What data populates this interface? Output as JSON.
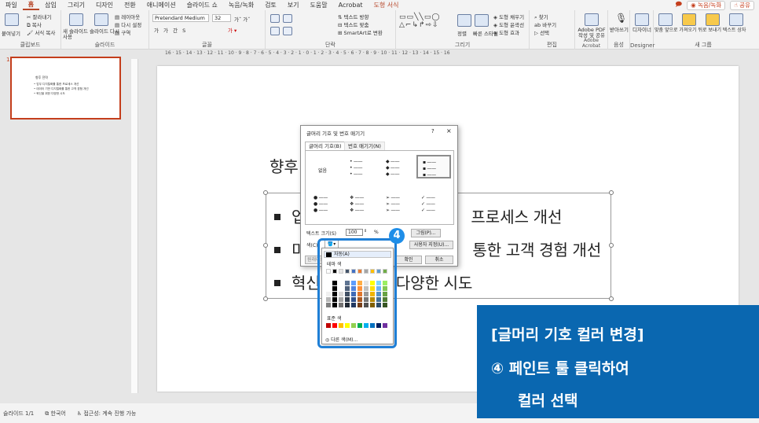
{
  "menubar": {
    "items": [
      "파일",
      "홈",
      "삽입",
      "그리기",
      "디자인",
      "전환",
      "애니메이션",
      "슬라이드 쇼",
      "녹음/녹화",
      "검토",
      "보기",
      "도움말",
      "Acrobat",
      "도형 서식"
    ],
    "active_index": 1,
    "contextual_index": 13,
    "record_label": "◉ 녹음/녹화",
    "share_label": "☝ 공유"
  },
  "ribbon": {
    "clipboard": {
      "paste": "붙여넣기",
      "cut": "잘라내기",
      "copy": "복사",
      "format_painter": "서식 복사",
      "label": "클립보드"
    },
    "slides": {
      "new_slide": "새 슬라이드",
      "reuse": "슬라이드 다시 사용",
      "layout": "레이아웃",
      "reset": "다시 설정",
      "section": "구역",
      "label": "슬라이드"
    },
    "font": {
      "name": "Pretendard Medium",
      "size": "32",
      "label": "글꼴"
    },
    "paragraph": {
      "text_direction": "텍스트 방향",
      "align_text": "텍스트 맞춤",
      "smartart": "SmartArt로 변환",
      "label": "단락"
    },
    "drawing": {
      "arrange": "정렬",
      "quick_styles": "빠른 스타일",
      "fill": "도형 채우기",
      "outline": "도형 윤곽선",
      "effects": "도형 효과",
      "label": "그리기"
    },
    "editing": {
      "find": "찾기",
      "replace": "바꾸기",
      "select": "선택",
      "label": "편집"
    },
    "acrobat": {
      "create_pdf": "Adobe PDF 작성 및 공유",
      "label": "Adobe Acrobat"
    },
    "voice": {
      "dictate": "받아쓰기",
      "label": "음성"
    },
    "designer": {
      "designer": "디자이너",
      "label": "Designer"
    },
    "new_group": {
      "fit": "맞춤",
      "bring_forward": "앞으로 가져오기",
      "send_back": "뒤로 보내기",
      "textbox": "텍스트 상자",
      "label": "새 그룹"
    }
  },
  "ruler": {
    "ticks": "16 · 15 · 14 · 13 · 12 · 11 · 10 · 9 · 8 · 7 · 6 · 5 · 4 · 3 · 2 · 1 · 0 · 1 · 2 · 3 · 4 · 5 · 6 · 7 · 8 · 9 · 10 · 11 · 12 · 13 · 14 · 15 · 16"
  },
  "thumbnail": {
    "number": "1",
    "title": "향후 전략",
    "lines": [
      "업무 디지털화를 통한 프로세스 개선",
      "데이터 기반 디지털화를 통한 고객 경험 개선",
      "혁신을 위한 다양한 시도"
    ]
  },
  "slide": {
    "title": "향후",
    "bullets": [
      {
        "left": "업",
        "right": "프로세스 개선"
      },
      {
        "left": "미",
        "right": "통한 고객 경험 개선"
      },
      {
        "left": "혁신",
        "right": "다양한 시도"
      }
    ]
  },
  "dialog": {
    "title": "글머리 기호 및 번호 매기기",
    "help": "?",
    "close": "×",
    "tab_bullets": "글머리 기호(B)",
    "tab_numbers": "번호 매기기(N)",
    "none_label": "없음",
    "size_label": "텍스트 크기(S)",
    "size_value": "100",
    "percent": "%",
    "color_label": "색(C)",
    "picture_btn": "그림(P)...",
    "custom_btn": "사용자 지정(U)...",
    "reset_btn": "원래대로",
    "ok_btn": "확인",
    "cancel_btn": "취소"
  },
  "palette": {
    "auto": "자동(A)",
    "theme_label": "테마 색",
    "standard_label": "표준 색",
    "more_colors": "다른 색(M)...",
    "theme_colors": [
      "#ffffff",
      "#000000",
      "#e7e6e6",
      "#44546a",
      "#4472c4",
      "#ed7d31",
      "#a5a5a5",
      "#ffc000",
      "#5b9bd5",
      "#70ad47"
    ],
    "standard_colors": [
      "#c00000",
      "#ff0000",
      "#ffc000",
      "#ffff00",
      "#92d050",
      "#00b050",
      "#00b0f0",
      "#0070c0",
      "#002060",
      "#7030a0"
    ]
  },
  "badge": {
    "number": "4"
  },
  "callout": {
    "line1": "[글머리 기호 컬러 변경]",
    "line2": "④ 페인트 툴 클릭하여",
    "line3": "컬러 선택"
  },
  "status": {
    "slide": "슬라이드 1/1",
    "lang": "한국어",
    "accessibility": "접근성: 계속 진행 가능"
  }
}
